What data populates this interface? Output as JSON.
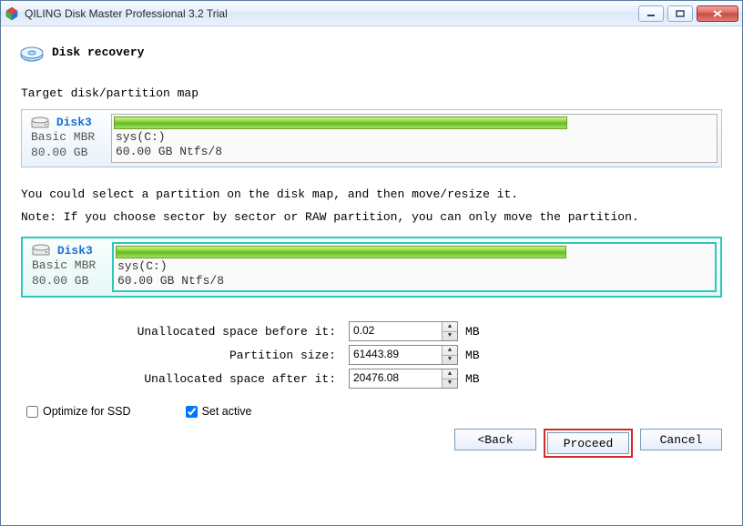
{
  "window_title": "QILING Disk Master Professional 3.2 Trial",
  "header_title": "Disk recovery",
  "section_label": "Target disk/partition map",
  "info_text": "You could select a partition on the disk map, and then move/resize it.",
  "note_text": "Note: If you choose sector by sector or RAW partition, you can only move the partition.",
  "disk1": {
    "name": "Disk3",
    "type": "Basic MBR",
    "size": "80.00 GB",
    "part_label": "sys(C:)",
    "part_size": "60.00 GB Ntfs/8"
  },
  "disk2": {
    "name": "Disk3",
    "type": "Basic MBR",
    "size": "80.00 GB",
    "part_label": "sys(C:)",
    "part_size": "60.00 GB Ntfs/8"
  },
  "form": {
    "before_label": "Unallocated space before it:",
    "before_value": "0.02",
    "size_label": "Partition size:",
    "size_value": "61443.89",
    "after_label": "Unallocated space after it:",
    "after_value": "20476.08",
    "unit": "MB"
  },
  "checks": {
    "ssd": "Optimize for SSD",
    "active": "Set active"
  },
  "buttons": {
    "back": "<Back",
    "proceed": "Proceed",
    "cancel": "Cancel"
  }
}
